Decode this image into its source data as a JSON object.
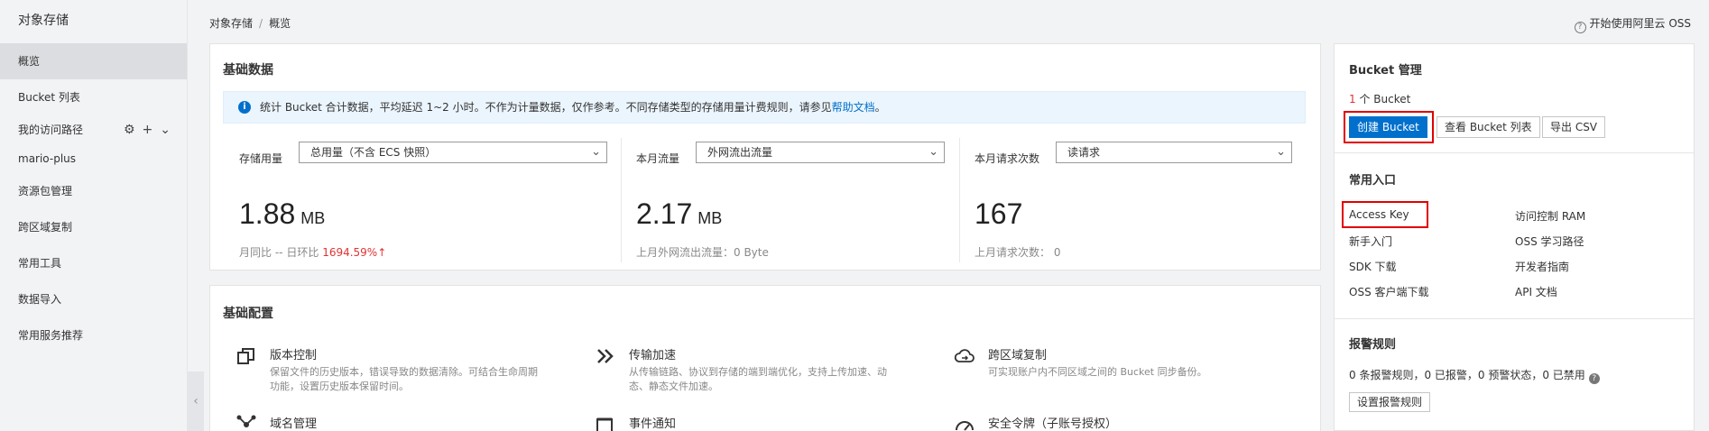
{
  "sidebar": {
    "title": "对象存储",
    "items": [
      {
        "label": "概览",
        "active": true
      },
      {
        "label": "Bucket 列表"
      },
      {
        "label": "我的访问路径"
      },
      {
        "label": "mario-plus"
      },
      {
        "label": "资源包管理"
      },
      {
        "label": "跨区域复制"
      },
      {
        "label": "常用工具"
      },
      {
        "label": "数据导入"
      },
      {
        "label": "常用服务推荐"
      }
    ],
    "route_icons": [
      "gear-icon",
      "plus-icon",
      "chevron-down-icon"
    ],
    "collapse_icon": "chevron-left-icon"
  },
  "breadcrumb": {
    "root": "对象存储",
    "separator": "/",
    "current": "概览"
  },
  "help": {
    "icon": "question-circle-icon",
    "label": "开始使用阿里云 OSS"
  },
  "basic_data": {
    "title": "基础数据",
    "notice_icon": "info-icon",
    "notice_text": "统计 Bucket 合计数据，平均延迟 1~2 小时。不作为计量数据，仅作参考。不同存储类型的存储用量计费规则，请参见",
    "notice_link": "帮助文档",
    "notice_end": "。",
    "storage": {
      "label": "存储用量",
      "select": "总用量（不含 ECS 快照）",
      "value": "1.88",
      "unit": "MB",
      "yoy_label": "月同比",
      "yoy_value": "--",
      "dod_label": "日环比",
      "dod_value": "1694.59%",
      "trend_icon": "arrow-up-icon",
      "trend_symbol": "↑"
    },
    "traffic": {
      "label": "本月流量",
      "select": "外网流出流量",
      "value": "2.17",
      "unit": "MB",
      "sub": "上月外网流出流量：0 Byte"
    },
    "requests": {
      "label": "本月请求次数",
      "select": "读请求",
      "value": "167",
      "sub": "上月请求次数：  0"
    }
  },
  "basic_config": {
    "title": "基础配置",
    "features": [
      {
        "title": "版本控制",
        "desc": "保留文件的历史版本，错误导致的数据清除。可结合生命周期功能，设置历史版本保留时间。",
        "icon": "version-control-icon"
      },
      {
        "title": "传输加速",
        "desc": "从传输链路、协议到存储的端到端优化，支持上传加速、动态、静态文件加速。",
        "icon": "double-chevron-right-icon"
      },
      {
        "title": "跨区域复制",
        "desc": "可实现账户内不同区域之间的 Bucket 同步备份。",
        "icon": "cloud-sync-icon"
      },
      {
        "title": "域名管理",
        "desc": "",
        "icon": "network-nodes-icon"
      },
      {
        "title": "事件通知",
        "desc": "",
        "icon": "notification-icon"
      },
      {
        "title": "安全令牌（子账号授权）",
        "desc": "",
        "icon": "gauge-icon"
      }
    ]
  },
  "bucket_mgmt": {
    "title": "Bucket 管理",
    "count": "1",
    "count_suffix": " 个 Bucket",
    "create_btn": "创建 Bucket",
    "list_btn": "查看 Bucket 列表",
    "export_btn": "导出 CSV"
  },
  "common_entry": {
    "title": "常用入口",
    "links": [
      "Access Key",
      "访问控制 RAM",
      "新手入门",
      "OSS 学习路径",
      "SDK 下载",
      "开发者指南",
      "OSS 客户端下载",
      "API 文档"
    ]
  },
  "alarm": {
    "title": "报警规则",
    "summary": "0 条报警规则，0 已报警，0 预警状态，0 已禁用",
    "help_icon": "question-icon",
    "button": "设置报警规则"
  },
  "colors": {
    "primary": "#0070cc",
    "highlight_box": "#e00000",
    "negative": "#e03333"
  }
}
